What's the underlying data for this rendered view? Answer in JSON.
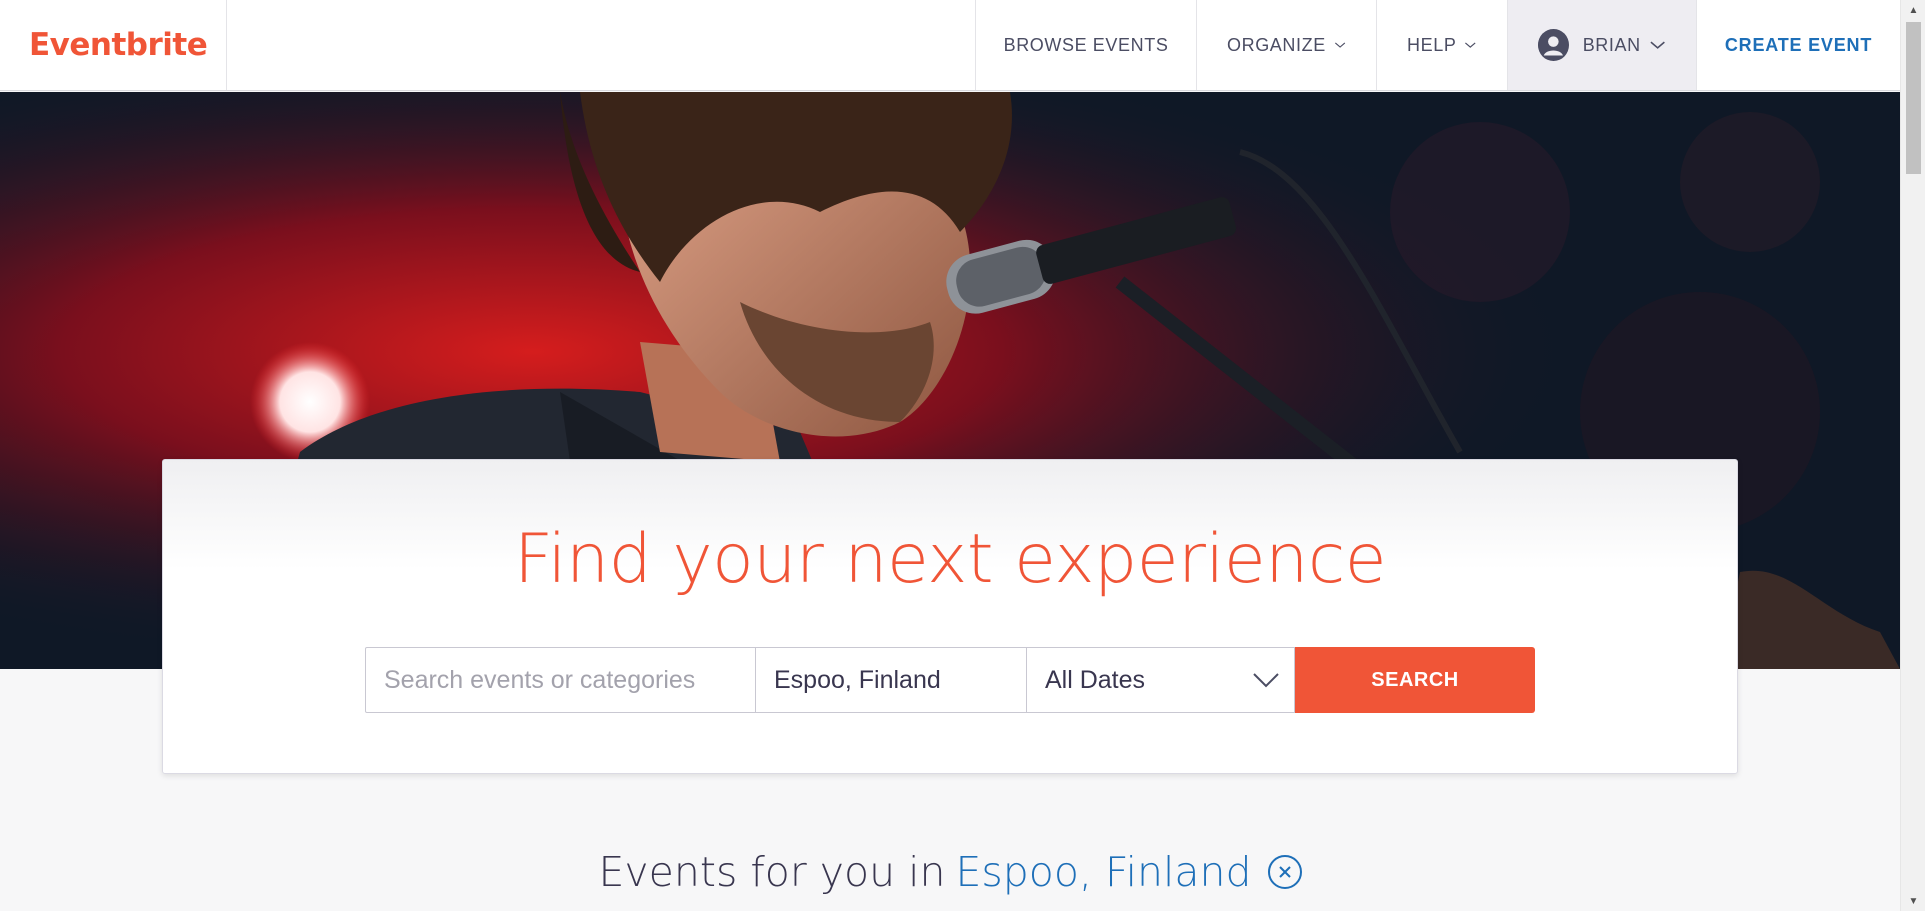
{
  "header": {
    "logo": "Eventbrite",
    "nav": {
      "browse": "BROWSE EVENTS",
      "organize": "ORGANIZE",
      "help": "HELP",
      "user": "BRIAN",
      "create": "CREATE EVENT"
    }
  },
  "hero": {
    "image_description_icon": "concert-photo"
  },
  "search": {
    "headline": "Find your next experience",
    "query_placeholder": "Search events or categories",
    "location_value": "Espoo, Finland",
    "date_value": "All Dates",
    "button_label": "SEARCH"
  },
  "events": {
    "prefix": "Events for you in",
    "location": "Espoo, Finland"
  },
  "colors": {
    "brand": "#f05537",
    "link": "#1e6fb8",
    "text": "#39364f"
  }
}
